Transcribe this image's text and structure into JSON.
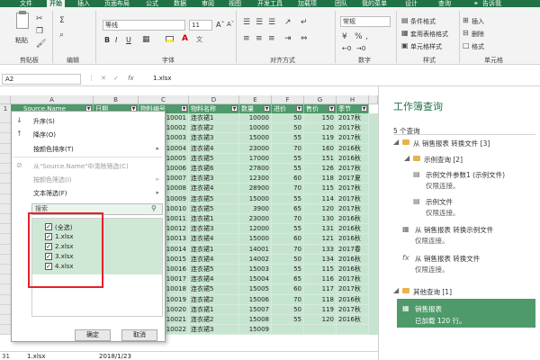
{
  "ribbon": {
    "tabs": [
      "文件",
      "开始",
      "插入",
      "页面布局",
      "公式",
      "数据",
      "审阅",
      "视图",
      "开发工具",
      "加载项",
      "团队",
      "我的菜单",
      "设计",
      "查询"
    ],
    "tell_me": "告诉我",
    "clipboard": {
      "paste": "粘贴",
      "label": "剪贴板"
    },
    "edit_label": "编辑",
    "font": {
      "name": "等线",
      "size": "11",
      "label": "字体",
      "bold": "B",
      "italic": "I",
      "underline": "U"
    },
    "alignment_label": "对齐方式",
    "number": {
      "format": "常规",
      "label": "数字"
    },
    "styles": {
      "conditional": "条件格式",
      "table": "套用表格格式",
      "cell": "单元格样式",
      "label": "样式"
    },
    "cells": {
      "insert": "插入",
      "delete": "删除",
      "format": "格式",
      "label": "单元格"
    }
  },
  "formula_bar": {
    "name_box": "A2",
    "fx": "fx",
    "value": "1.xlsx"
  },
  "grid": {
    "columns": [
      "A",
      "B",
      "C",
      "D",
      "E",
      "F",
      "G",
      "H"
    ],
    "headers": [
      "Source.Name",
      "日期",
      "物料编号",
      "物料名称",
      "数量",
      "进价",
      "售价",
      "季节"
    ],
    "rows": [
      [
        "10001",
        "连衣裙1",
        "10000",
        "50",
        "150",
        "2017秋"
      ],
      [
        "10002",
        "连衣裙2",
        "10000",
        "50",
        "120",
        "2017秋"
      ],
      [
        "10003",
        "连衣裙3",
        "15000",
        "55",
        "119",
        "2017秋"
      ],
      [
        "10004",
        "连衣裙4",
        "23000",
        "70",
        "160",
        "2016秋"
      ],
      [
        "10005",
        "连衣裙5",
        "17000",
        "55",
        "151",
        "2016秋"
      ],
      [
        "10006",
        "连衣裙6",
        "27800",
        "55",
        "126",
        "2017秋"
      ],
      [
        "10007",
        "连衣裙3",
        "12300",
        "60",
        "118",
        "2017夏"
      ],
      [
        "10008",
        "连衣裙4",
        "28900",
        "70",
        "115",
        "2017秋"
      ],
      [
        "10009",
        "连衣裙5",
        "15000",
        "55",
        "114",
        "2017秋"
      ],
      [
        "10010",
        "连衣裙5",
        "3900",
        "65",
        "120",
        "2017秋"
      ],
      [
        "10011",
        "连衣裙1",
        "23000",
        "70",
        "130",
        "2016秋"
      ],
      [
        "10012",
        "连衣裙3",
        "12000",
        "55",
        "131",
        "2016秋"
      ],
      [
        "10013",
        "连衣裙4",
        "15000",
        "60",
        "121",
        "2016秋"
      ],
      [
        "10014",
        "连衣裙1",
        "14001",
        "70",
        "133",
        "2017春"
      ],
      [
        "10015",
        "连衣裙4",
        "14002",
        "50",
        "134",
        "2016秋"
      ],
      [
        "10016",
        "连衣裙5",
        "15003",
        "55",
        "115",
        "2016秋"
      ],
      [
        "10017",
        "连衣裙4",
        "15004",
        "65",
        "116",
        "2017秋"
      ],
      [
        "10018",
        "连衣裙5",
        "15005",
        "60",
        "117",
        "2017秋"
      ],
      [
        "10019",
        "连衣裙2",
        "15006",
        "70",
        "118",
        "2016秋"
      ],
      [
        "10020",
        "连衣裙1",
        "15007",
        "50",
        "119",
        "2017秋"
      ],
      [
        "10021",
        "连衣裙2",
        "15008",
        "55",
        "120",
        "2016秋"
      ],
      [
        "10022",
        "连衣裙3",
        "15009",
        "",
        "",
        ""
      ]
    ],
    "bottom_row": {
      "num": "31",
      "source": "1.xlsx",
      "date": "2018/1/23"
    }
  },
  "dropdown": {
    "sort_asc": "升序(S)",
    "sort_desc": "降序(O)",
    "sort_color": "按颜色排序(T)",
    "clear_filter": "从\"Source.Name\"中清除筛选(C)",
    "filter_color": "按颜色筛选(I)",
    "text_filter": "文本筛选(F)",
    "search_placeholder": "搜索",
    "items": [
      "(全选)",
      "1.xlsx",
      "2.xlsx",
      "3.xlsx",
      "4.xlsx"
    ],
    "ok": "确定",
    "cancel": "取消"
  },
  "pane": {
    "title": "工作簿查询",
    "count": "5 个查询",
    "group1": "从 销售报表 转换文件 [3]",
    "subgroup": "示例查询 [2]",
    "q1": "示例文件参数1 (示例文件)",
    "q1_sub": "仅限连接。",
    "q2": "示例文件",
    "q2_sub": "仅限连接。",
    "q3": "从 销售报表 转换示例文件",
    "q3_sub": "仅限连接。",
    "q4": "从 销售报表 转换文件",
    "q4_sub": "仅限连接。",
    "group2": "其他查询 [1]",
    "q5": "销售报表",
    "q5_sub": "已加载 120 行。"
  },
  "colors": {
    "excel_green": "#217346",
    "header_green": "#4e9a6a",
    "row_green": "#c6e5cf",
    "highlight_red": "#e8202a"
  }
}
